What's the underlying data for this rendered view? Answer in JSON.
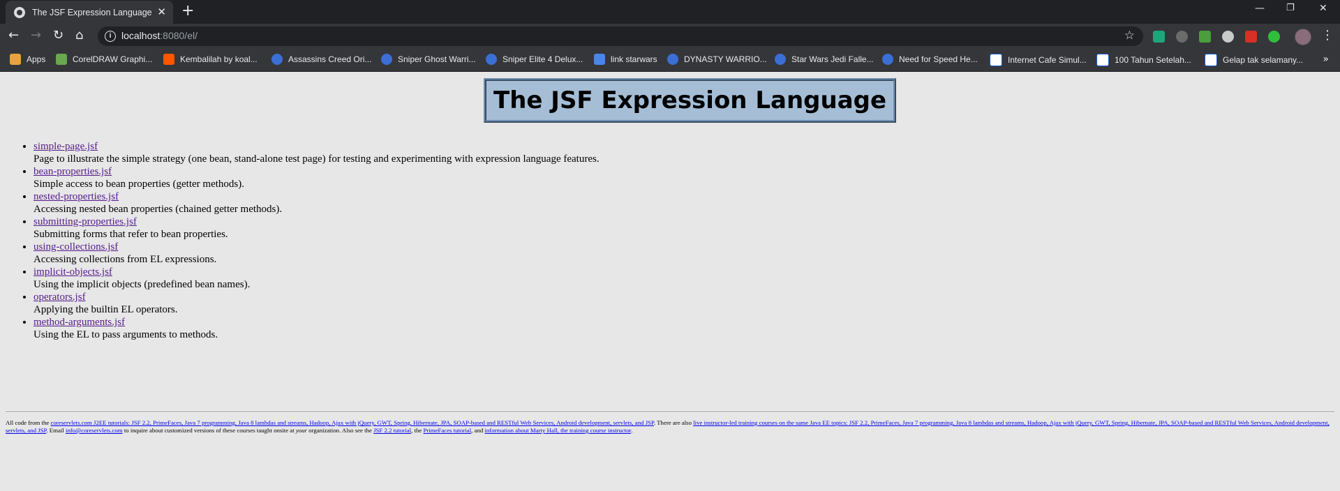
{
  "browser": {
    "tab_title": "The JSF Expression Language",
    "url_host": "localhost",
    "url_rest": ":8080/el/",
    "bookmarks": [
      {
        "label": "Apps",
        "icon": "apps-grid-icon",
        "color": "#e8a33d"
      },
      {
        "label": "CorelDRAW Graphi...",
        "icon": "coreldraw-icon",
        "color": "#6aa84f"
      },
      {
        "label": "Kembalilah by koal...",
        "icon": "soundcloud-icon",
        "color": "#ff5500"
      },
      {
        "label": "Assassins Creed Ori...",
        "icon": "game-site-icon",
        "color": "#3b6fd6"
      },
      {
        "label": "Sniper Ghost Warri...",
        "icon": "game-site-icon",
        "color": "#3b6fd6"
      },
      {
        "label": "Sniper Elite 4 Delux...",
        "icon": "game-site-icon",
        "color": "#3b6fd6"
      },
      {
        "label": "link starwars",
        "icon": "bookmark-page-icon",
        "color": "#4a86e8"
      },
      {
        "label": "DYNASTY WARRIO...",
        "icon": "game-site-icon",
        "color": "#3b6fd6"
      },
      {
        "label": "Star Wars Jedi Falle...",
        "icon": "game-site-icon",
        "color": "#3b6fd6"
      },
      {
        "label": "Need for Speed He...",
        "icon": "game-site-icon",
        "color": "#3b6fd6"
      },
      {
        "label": "Internet Cafe Simul...",
        "icon": "k-site-icon",
        "color": "#ffffff"
      },
      {
        "label": "100 Tahun Setelah...",
        "icon": "k-site-icon",
        "color": "#ffffff"
      },
      {
        "label": "Gelap tak selamany...",
        "icon": "k-site-icon",
        "color": "#ffffff"
      }
    ],
    "more_bookmarks": "»"
  },
  "page": {
    "title": "The JSF Expression Language",
    "items": [
      {
        "link": "simple-page.jsf",
        "desc": "Page to illustrate the simple strategy (one bean, stand-alone test page) for testing and experimenting with expression language features."
      },
      {
        "link": "bean-properties.jsf",
        "desc": "Simple access to bean properties (getter methods)."
      },
      {
        "link": "nested-properties.jsf",
        "desc": "Accessing nested bean properties (chained getter methods)."
      },
      {
        "link": "submitting-properties.jsf",
        "desc": "Submitting forms that refer to bean properties."
      },
      {
        "link": "using-collections.jsf",
        "desc": "Accessing collections from EL expressions."
      },
      {
        "link": "implicit-objects.jsf",
        "desc": "Using the implicit objects (predefined bean names)."
      },
      {
        "link": "operators.jsf",
        "desc": "Applying the builtin EL operators."
      },
      {
        "link": "method-arguments.jsf",
        "desc": "Using the EL to pass arguments to methods."
      }
    ],
    "footer": {
      "t1": "All code from the ",
      "l1": "coreservlets.com J2EE tutorials: JSF 2.2, PrimeFaces, Java 7 programming, Java 8 lambdas and streams, Hadoop, Ajax with jQuery, GWT, Spring, Hibernate, JPA, SOAP-based and RESTful Web Services, Android development, servlets, and JSP",
      "t2": ". There are also ",
      "l2": "live instructor-led training courses on the same Java EE topics: JSF 2.2, PrimeFaces, Java 7 programming, Java 8 lambdas and streams, Hadoop, Ajax with jQuery, GWT, Spring, Hibernate, JPA, SOAP-based and RESTful Web Services, Android development, servlets, and JSP",
      "t3": ". Email ",
      "l3": "info@coreservlets.com",
      "t4": " to inquire about customized versions of these courses taught onsite at ",
      "t4_em": "your",
      "t5": " organization. Also see the ",
      "l4": "JSF 2.2 tutorial",
      "t6": ", the ",
      "l5": "PrimeFaces tutorial",
      "t7": ", and ",
      "l6": "information about Marty Hall, the training course instructor",
      "t8": "."
    }
  }
}
